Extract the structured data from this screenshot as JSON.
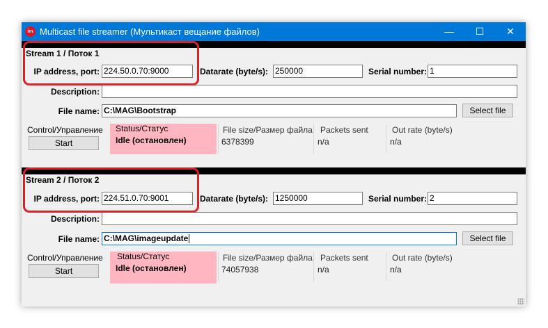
{
  "window": {
    "title": "Multicast file streamer (Мультикаст вещание файлов)",
    "app_icon_text": "im",
    "controls": {
      "minimize": "—",
      "maximize": "☐",
      "close": "✕"
    }
  },
  "streams": [
    {
      "title": "Stream 1 / Поток 1",
      "ip_label": "IP address, port:",
      "ip_value": "224.50.0.70:9000",
      "datarate_label": "Datarate (byte/s):",
      "datarate_value": "250000",
      "serial_label": "Serial number:",
      "serial_value": "1",
      "description_label": "Description:",
      "description_value": "",
      "filename_label": "File name:",
      "filename_value": "C:\\MAG\\Bootstrap",
      "select_file_label": "Select file",
      "control_label": "Control/Управление",
      "start_label": "Start",
      "status_label": "Status/Статус",
      "status_value": "Idle (остановлен)",
      "filesize_label": "File size/Размер файла",
      "filesize_value": "6378399",
      "packets_label": "Packets sent",
      "packets_value": "n/a",
      "outrate_label": "Out rate (byte/s)",
      "outrate_value": "n/a"
    },
    {
      "title": "Stream 2 / Поток 2",
      "ip_label": "IP address, port:",
      "ip_value": "224.51.0.70:9001",
      "datarate_label": "Datarate (byte/s):",
      "datarate_value": "1250000",
      "serial_label": "Serial number:",
      "serial_value": "2",
      "description_label": "Description:",
      "description_value": "",
      "filename_label": "File name:",
      "filename_value": "C:\\MAG\\imageupdate",
      "select_file_label": "Select file",
      "control_label": "Control/Управление",
      "start_label": "Start",
      "status_label": "Status/Статус",
      "status_value": "Idle (остановлен)",
      "filesize_label": "File size/Размер файла",
      "filesize_value": "74057938",
      "packets_label": "Packets sent",
      "packets_value": "n/a",
      "outrate_label": "Out rate (byte/s)",
      "outrate_value": "n/a"
    }
  ],
  "colors": {
    "titlebar": "#0078d7",
    "status_background": "#ffb6c1",
    "highlight": "#d92128",
    "separator": "#000000"
  }
}
